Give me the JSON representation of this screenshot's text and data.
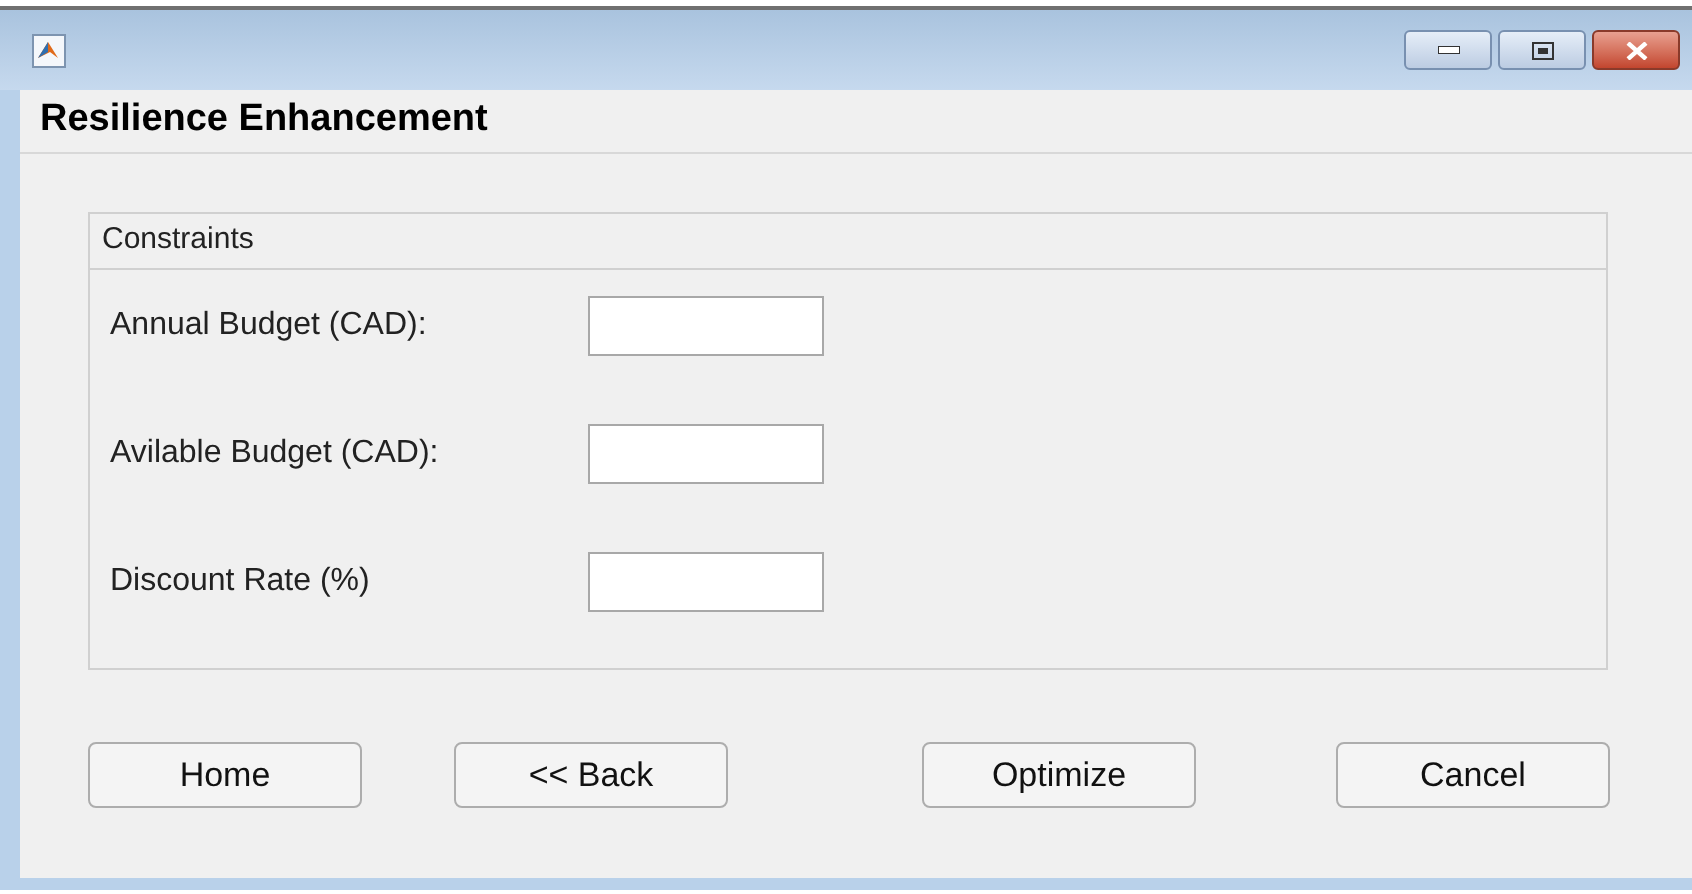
{
  "header": "Resilience Enhancement",
  "panel": {
    "title": "Constraints",
    "fields": [
      {
        "label": "Annual Budget (CAD):"
      },
      {
        "label": "Avilable Budget (CAD):"
      },
      {
        "label": "Discount Rate (%)"
      }
    ]
  },
  "buttons": [
    "Home",
    "<< Back",
    "Optimize",
    "Cancel"
  ]
}
